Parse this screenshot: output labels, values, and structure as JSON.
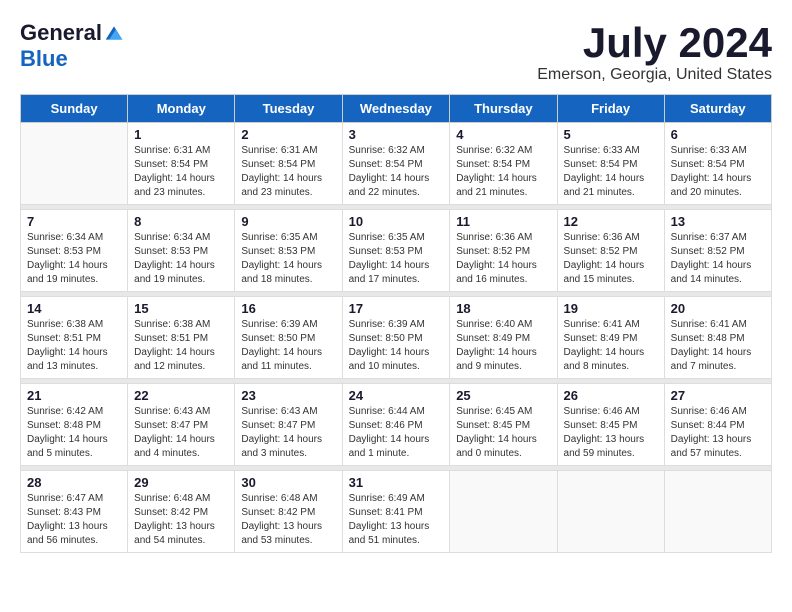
{
  "header": {
    "logo_general": "General",
    "logo_blue": "Blue",
    "month_title": "July 2024",
    "location": "Emerson, Georgia, United States"
  },
  "days_of_week": [
    "Sunday",
    "Monday",
    "Tuesday",
    "Wednesday",
    "Thursday",
    "Friday",
    "Saturday"
  ],
  "weeks": [
    [
      {
        "day": "",
        "info": ""
      },
      {
        "day": "1",
        "info": "Sunrise: 6:31 AM\nSunset: 8:54 PM\nDaylight: 14 hours\nand 23 minutes."
      },
      {
        "day": "2",
        "info": "Sunrise: 6:31 AM\nSunset: 8:54 PM\nDaylight: 14 hours\nand 23 minutes."
      },
      {
        "day": "3",
        "info": "Sunrise: 6:32 AM\nSunset: 8:54 PM\nDaylight: 14 hours\nand 22 minutes."
      },
      {
        "day": "4",
        "info": "Sunrise: 6:32 AM\nSunset: 8:54 PM\nDaylight: 14 hours\nand 21 minutes."
      },
      {
        "day": "5",
        "info": "Sunrise: 6:33 AM\nSunset: 8:54 PM\nDaylight: 14 hours\nand 21 minutes."
      },
      {
        "day": "6",
        "info": "Sunrise: 6:33 AM\nSunset: 8:54 PM\nDaylight: 14 hours\nand 20 minutes."
      }
    ],
    [
      {
        "day": "7",
        "info": "Sunrise: 6:34 AM\nSunset: 8:53 PM\nDaylight: 14 hours\nand 19 minutes."
      },
      {
        "day": "8",
        "info": "Sunrise: 6:34 AM\nSunset: 8:53 PM\nDaylight: 14 hours\nand 19 minutes."
      },
      {
        "day": "9",
        "info": "Sunrise: 6:35 AM\nSunset: 8:53 PM\nDaylight: 14 hours\nand 18 minutes."
      },
      {
        "day": "10",
        "info": "Sunrise: 6:35 AM\nSunset: 8:53 PM\nDaylight: 14 hours\nand 17 minutes."
      },
      {
        "day": "11",
        "info": "Sunrise: 6:36 AM\nSunset: 8:52 PM\nDaylight: 14 hours\nand 16 minutes."
      },
      {
        "day": "12",
        "info": "Sunrise: 6:36 AM\nSunset: 8:52 PM\nDaylight: 14 hours\nand 15 minutes."
      },
      {
        "day": "13",
        "info": "Sunrise: 6:37 AM\nSunset: 8:52 PM\nDaylight: 14 hours\nand 14 minutes."
      }
    ],
    [
      {
        "day": "14",
        "info": "Sunrise: 6:38 AM\nSunset: 8:51 PM\nDaylight: 14 hours\nand 13 minutes."
      },
      {
        "day": "15",
        "info": "Sunrise: 6:38 AM\nSunset: 8:51 PM\nDaylight: 14 hours\nand 12 minutes."
      },
      {
        "day": "16",
        "info": "Sunrise: 6:39 AM\nSunset: 8:50 PM\nDaylight: 14 hours\nand 11 minutes."
      },
      {
        "day": "17",
        "info": "Sunrise: 6:39 AM\nSunset: 8:50 PM\nDaylight: 14 hours\nand 10 minutes."
      },
      {
        "day": "18",
        "info": "Sunrise: 6:40 AM\nSunset: 8:49 PM\nDaylight: 14 hours\nand 9 minutes."
      },
      {
        "day": "19",
        "info": "Sunrise: 6:41 AM\nSunset: 8:49 PM\nDaylight: 14 hours\nand 8 minutes."
      },
      {
        "day": "20",
        "info": "Sunrise: 6:41 AM\nSunset: 8:48 PM\nDaylight: 14 hours\nand 7 minutes."
      }
    ],
    [
      {
        "day": "21",
        "info": "Sunrise: 6:42 AM\nSunset: 8:48 PM\nDaylight: 14 hours\nand 5 minutes."
      },
      {
        "day": "22",
        "info": "Sunrise: 6:43 AM\nSunset: 8:47 PM\nDaylight: 14 hours\nand 4 minutes."
      },
      {
        "day": "23",
        "info": "Sunrise: 6:43 AM\nSunset: 8:47 PM\nDaylight: 14 hours\nand 3 minutes."
      },
      {
        "day": "24",
        "info": "Sunrise: 6:44 AM\nSunset: 8:46 PM\nDaylight: 14 hours\nand 1 minute."
      },
      {
        "day": "25",
        "info": "Sunrise: 6:45 AM\nSunset: 8:45 PM\nDaylight: 14 hours\nand 0 minutes."
      },
      {
        "day": "26",
        "info": "Sunrise: 6:46 AM\nSunset: 8:45 PM\nDaylight: 13 hours\nand 59 minutes."
      },
      {
        "day": "27",
        "info": "Sunrise: 6:46 AM\nSunset: 8:44 PM\nDaylight: 13 hours\nand 57 minutes."
      }
    ],
    [
      {
        "day": "28",
        "info": "Sunrise: 6:47 AM\nSunset: 8:43 PM\nDaylight: 13 hours\nand 56 minutes."
      },
      {
        "day": "29",
        "info": "Sunrise: 6:48 AM\nSunset: 8:42 PM\nDaylight: 13 hours\nand 54 minutes."
      },
      {
        "day": "30",
        "info": "Sunrise: 6:48 AM\nSunset: 8:42 PM\nDaylight: 13 hours\nand 53 minutes."
      },
      {
        "day": "31",
        "info": "Sunrise: 6:49 AM\nSunset: 8:41 PM\nDaylight: 13 hours\nand 51 minutes."
      },
      {
        "day": "",
        "info": ""
      },
      {
        "day": "",
        "info": ""
      },
      {
        "day": "",
        "info": ""
      }
    ]
  ]
}
